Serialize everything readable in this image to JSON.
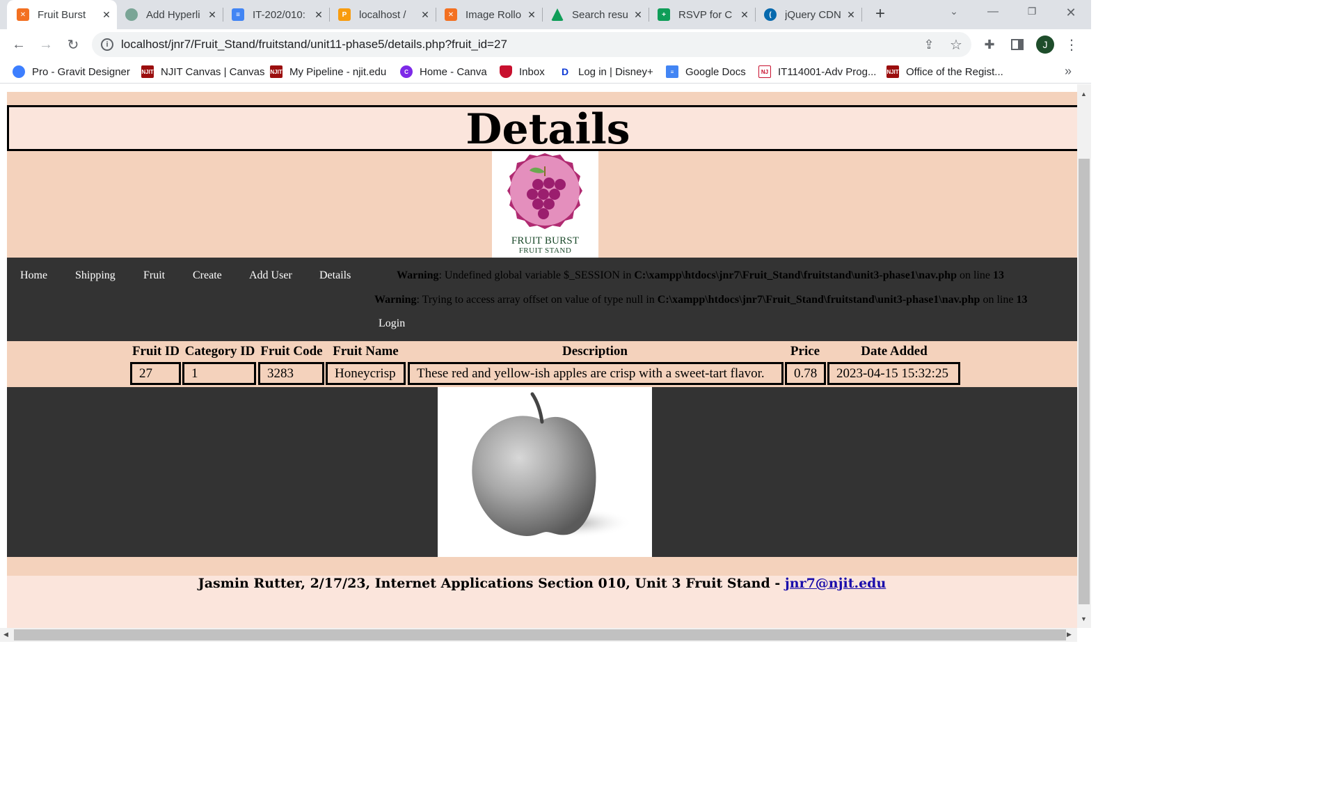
{
  "browser": {
    "tabs": [
      {
        "title": "Fruit Burst",
        "active": true,
        "icon": "xampp-icon",
        "color": "#f37021"
      },
      {
        "title": "Add Hyperli",
        "active": false,
        "icon": "chatgpt-icon",
        "color": "#7aa596"
      },
      {
        "title": "IT-202/010:",
        "active": false,
        "icon": "google-docs-icon",
        "color": "#4285f4"
      },
      {
        "title": "localhost /",
        "active": false,
        "icon": "phpmyadmin-icon",
        "color": "#f89c0e"
      },
      {
        "title": "Image Rollo",
        "active": false,
        "icon": "xampp-icon",
        "color": "#f37021"
      },
      {
        "title": "Search resu",
        "active": false,
        "icon": "google-drive-icon",
        "color": "#0f9d58"
      },
      {
        "title": "RSVP for C",
        "active": false,
        "icon": "google-sheets-icon",
        "color": "#0f9d58"
      },
      {
        "title": "jQuery CDN",
        "active": false,
        "icon": "jquery-icon",
        "color": "#0769ad"
      }
    ],
    "url": "localhost/jnr7/Fruit_Stand/fruitstand/unit11-phase5/details.php?fruit_id=27",
    "profile_initial": "J",
    "bookmarks": [
      {
        "label": "Pro - Gravit Designer",
        "icon": "gravit-icon",
        "color": "#3d7fff"
      },
      {
        "label": "NJIT Canvas | Canvas",
        "icon": "njit-icon",
        "color": "#9b0e0e"
      },
      {
        "label": "My Pipeline - njit.edu",
        "icon": "njit-icon",
        "color": "#9b0e0e"
      },
      {
        "label": "Home - Canva",
        "icon": "canva-icon",
        "color": "#7d2ae8"
      },
      {
        "label": "Inbox",
        "icon": "shield-icon",
        "color": "#c8102e"
      },
      {
        "label": "Log in | Disney+",
        "icon": "disney-icon",
        "color": "#0e3ad6"
      },
      {
        "label": "Google Docs",
        "icon": "google-docs-icon",
        "color": "#4285f4"
      },
      {
        "label": "IT114001-Adv Prog...",
        "icon": "njit-icon",
        "color": "#c8102e"
      },
      {
        "label": "Office of the Regist...",
        "icon": "njit-icon",
        "color": "#9b0e0e"
      }
    ]
  },
  "page": {
    "title": "Details",
    "logo": {
      "line1": "FRUIT BURST",
      "line2": "FRUIT STAND"
    },
    "nav": [
      "Home",
      "Shipping",
      "Fruit",
      "Create",
      "Add User",
      "Details"
    ],
    "login": "Login",
    "warnings": [
      {
        "label": "Warning",
        "text": ": Undefined global variable $_SESSION in ",
        "path": "C:\\xampp\\htdocs\\jnr7\\Fruit_Stand\\fruitstand\\unit3-phase1\\nav.php",
        "on_line": " on line ",
        "line": "13"
      },
      {
        "label": "Warning",
        "text": ": Trying to access array offset on value of type null in ",
        "path": "C:\\xampp\\htdocs\\jnr7\\Fruit_Stand\\fruitstand\\unit3-phase1\\nav.php",
        "on_line": " on line ",
        "line": "13"
      }
    ],
    "table": {
      "headers": [
        "Fruit ID",
        "Category ID",
        "Fruit Code",
        "Fruit Name",
        "Description",
        "Price",
        "Date Added"
      ],
      "row": [
        "27",
        "1",
        "3283",
        "Honeycrisp",
        "These red and yellow-ish apples are crisp with a sweet-tart flavor.",
        "0.78",
        "2023-04-15 15:32:25"
      ]
    },
    "footer": {
      "text": "Jasmin Rutter, 2/17/23, Internet Applications Section 010, Unit 3 Fruit Stand - ",
      "email": "jnr7@njit.edu"
    }
  },
  "colors": {
    "page_bg": "#f4d2bc",
    "header_bg": "#fbe5dc",
    "nav_bg": "#333333",
    "link": "#1a0dab"
  }
}
